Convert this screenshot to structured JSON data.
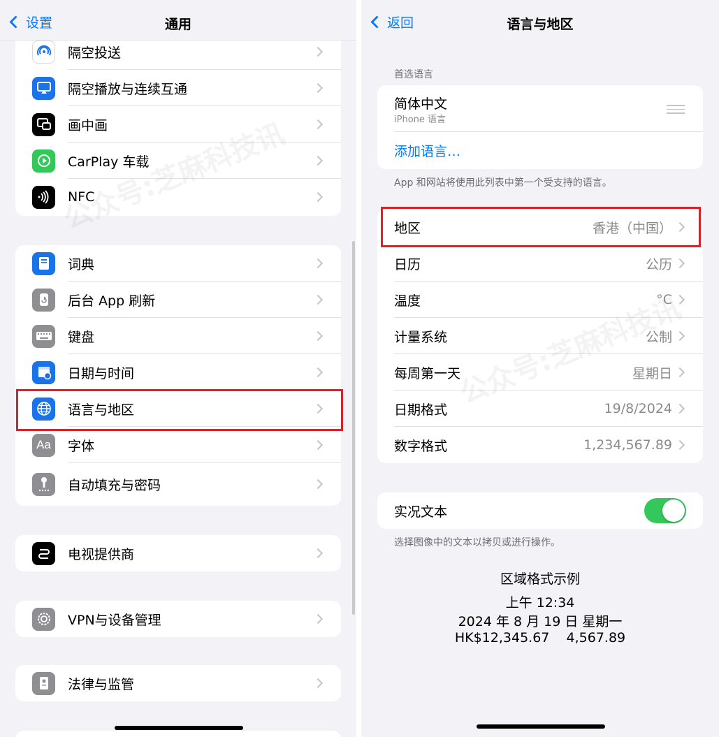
{
  "left": {
    "nav": {
      "back_label": "设置",
      "title": "通用"
    },
    "group1": [
      {
        "label": "隔空投送",
        "icon": "airdrop-icon",
        "color": "#ffffff"
      },
      {
        "label": "隔空播放与连续互通",
        "icon": "airplay-icon",
        "color": "#1a73e8"
      },
      {
        "label": "画中画",
        "icon": "picture-in-picture-icon",
        "color": "#000000"
      },
      {
        "label": "CarPlay 车载",
        "icon": "carplay-icon",
        "color": "#34c759"
      },
      {
        "label": "NFC",
        "icon": "nfc-icon",
        "color": "#000000"
      }
    ],
    "group2": [
      {
        "label": "词典",
        "icon": "dictionary-icon",
        "color": "#1a73e8"
      },
      {
        "label": "后台 App 刷新",
        "icon": "background-refresh-icon",
        "color": "#8e8e93"
      },
      {
        "label": "键盘",
        "icon": "keyboard-icon",
        "color": "#8e8e93"
      },
      {
        "label": "日期与时间",
        "icon": "calendar-clock-icon",
        "color": "#1a73e8"
      },
      {
        "label": "语言与地区",
        "icon": "globe-icon",
        "color": "#1a73e8"
      },
      {
        "label": "字体",
        "icon": "font-icon",
        "color": "#8e8e93"
      },
      {
        "label": "自动填充与密码",
        "icon": "key-icon",
        "color": "#8e8e93"
      }
    ],
    "group3": [
      {
        "label": "电视提供商",
        "icon": "tv-provider-icon",
        "color": "#000000"
      }
    ],
    "group4": [
      {
        "label": "VPN与设备管理",
        "icon": "gear-icon",
        "color": "#8e8e93"
      }
    ],
    "group5": [
      {
        "label": "法律与监管",
        "icon": "legal-icon",
        "color": "#8e8e93"
      }
    ]
  },
  "right": {
    "nav": {
      "back_label": "返回",
      "title": "语言与地区"
    },
    "preferred_header": "首选语言",
    "language": {
      "name": "简体中文",
      "sub": "iPhone 语言"
    },
    "add_language": "添加语言…",
    "languages_footnote": "App 和网站将使用此列表中第一个受支持的语言。",
    "settings": [
      {
        "label": "地区",
        "value": "香港（中国）"
      },
      {
        "label": "日历",
        "value": "公历"
      },
      {
        "label": "温度",
        "value": "°C"
      },
      {
        "label": "计量系统",
        "value": "公制"
      },
      {
        "label": "每周第一天",
        "value": "星期日"
      },
      {
        "label": "日期格式",
        "value": "19/8/2024"
      },
      {
        "label": "数字格式",
        "value": "1,234,567.89"
      }
    ],
    "live_text": {
      "label": "实况文本",
      "on": true,
      "footnote": "选择图像中的文本以拷贝或进行操作。"
    },
    "sample": {
      "title": "区域格式示例",
      "time": "上午 12:34",
      "date": "2024 年 8 月 19 日 星期一",
      "numbers": "HK$12,345.67    4,567.89"
    }
  },
  "watermark": "公众号:芝麻科技讯",
  "colors": {
    "accent": "#007aff",
    "highlight": "#d8232a",
    "toggle_on": "#34c759"
  }
}
